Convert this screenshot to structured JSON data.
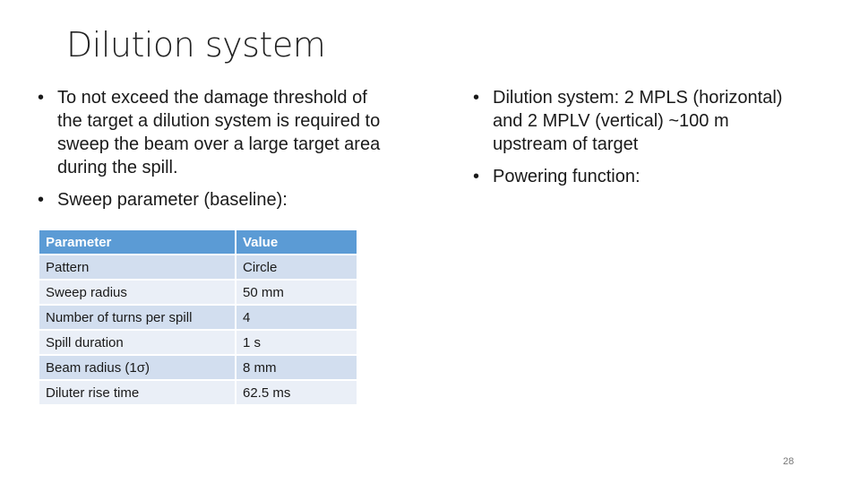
{
  "slide": {
    "title": "Dilution system",
    "left_bullets": [
      "To not exceed the damage threshold of the target a dilution system is required to sweep the beam over a large target area during the spill.",
      "Sweep parameter (baseline):"
    ],
    "right_bullets": [
      "Dilution system: 2 MPLS (horizontal) and 2 MPLV (vertical) ~100 m upstream of target",
      "Powering function:"
    ],
    "bullet_glyph": "•",
    "table": {
      "headers": [
        "Parameter",
        "Value"
      ],
      "rows": [
        [
          "Pattern",
          "Circle"
        ],
        [
          "Sweep radius",
          "50 mm"
        ],
        [
          "Number of turns per spill",
          "4"
        ],
        [
          "Spill duration",
          "1 s"
        ],
        [
          "Beam radius (1σ)",
          "8 mm"
        ],
        [
          "Diluter rise time",
          "62.5 ms"
        ]
      ]
    },
    "page_number": "28",
    "colors": {
      "table_header": "#5b9bd5",
      "row_dark": "#d2deef",
      "row_light": "#eaeff7"
    }
  }
}
